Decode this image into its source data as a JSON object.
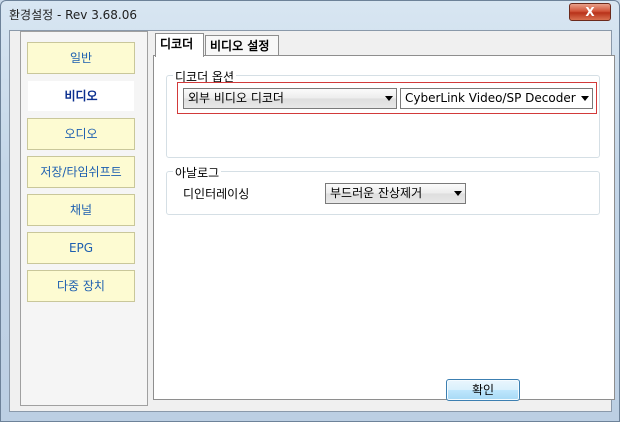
{
  "window": {
    "title": "환경설정 - Rev  3.68.06",
    "close_glyph": "X"
  },
  "sidebar": {
    "items": [
      {
        "label": "일반",
        "active": false
      },
      {
        "label": "비디오",
        "active": true
      },
      {
        "label": "오디오",
        "active": false
      },
      {
        "label": "저장/타임쉬프트",
        "active": false
      },
      {
        "label": "채널",
        "active": false
      },
      {
        "label": "EPG",
        "active": false
      },
      {
        "label": "다중 장치",
        "active": false
      }
    ]
  },
  "tabs": [
    {
      "label": "디코더",
      "active": true
    },
    {
      "label": "비디오 설정",
      "active": false
    }
  ],
  "decoder_group": {
    "title": "디코더 옵션",
    "decoder_type_value": "외부 비디오 디코더",
    "decoder_value": "CyberLink Video/SP Decoder (PD"
  },
  "analog_group": {
    "title": "아날로그",
    "deinterlace_label": "디인터레이싱",
    "deinterlace_value": "부드러운 잔상제거"
  },
  "ok_label": "확인",
  "colors": {
    "highlight_border": "#d23a3a",
    "sidebar_item_bg": "#fdfbd2",
    "sidebar_text": "#1d5fb0"
  }
}
